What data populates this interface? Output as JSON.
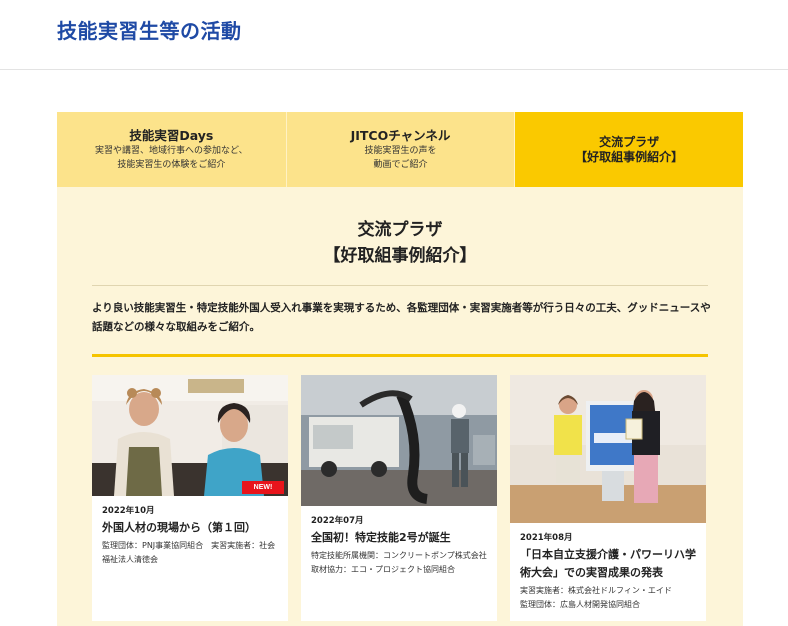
{
  "header": {
    "title": "技能実習生等の活動"
  },
  "tabs": [
    {
      "title": "技能実習Days",
      "sub1": "実習や講習、地域行事への参加など、",
      "sub2": "技能実習生の体験をご紹介"
    },
    {
      "title": "JITCOチャンネル",
      "sub1": "技能実習生の声を",
      "sub2": "動画でご紹介"
    },
    {
      "title1": "交流プラザ",
      "title2": "【好取組事例紹介】"
    }
  ],
  "section": {
    "title1": "交流プラザ",
    "title2": "【好取組事例紹介】",
    "description": "より良い技能実習生・特定技能外国人受入れ事業を実現するため、各監理団体・実習実施者等が行う日々の工夫、グッドニュースや話題などの様々な取組みをご紹介。"
  },
  "cards": [
    {
      "badge": "NEW!",
      "date": "2022年10月",
      "title": "外国人材の現場から（第１回）",
      "meta": "監理団体：PNJ事業協同組合　実習実施者：社会福祉法人清徳会"
    },
    {
      "date": "2022年07月",
      "title": "全国初！特定技能2号が誕生",
      "meta": "特定技能所属機関：コンクリートポンプ株式会社　取材協力：エコ・プロジェクト協同組合"
    },
    {
      "date": "2021年08月",
      "title": "「日本自立支援介護・パワーリハ学術大会」での実習成果の発表",
      "meta1": "実習実施者：株式会社ドルフィン・エイド",
      "meta2": "監理団体：広島人材開発協同組合"
    }
  ],
  "colors": {
    "title_blue": "#1f4aa5",
    "tab_yellow": "#fce38b",
    "tab_active": "#fac900",
    "panel_bg": "#fdf5d9",
    "accent": "#f5c400",
    "badge_red": "#e8141b"
  }
}
